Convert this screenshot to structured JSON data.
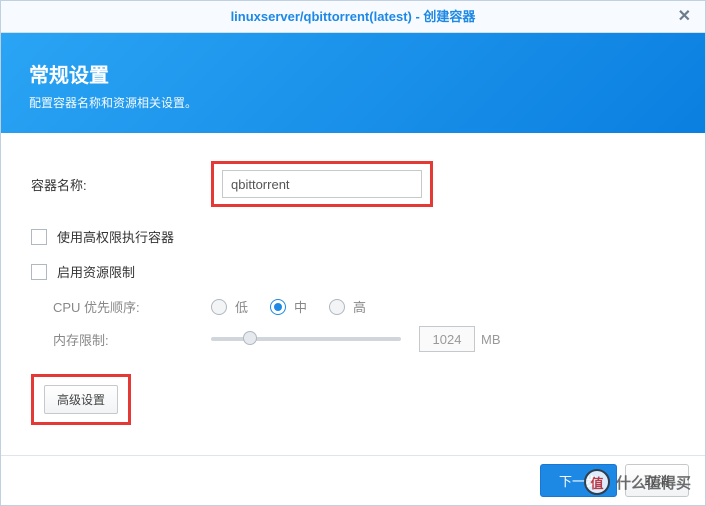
{
  "titlebar": {
    "title": "linuxserver/qbittorrent(latest) - 创建容器",
    "close": "✕"
  },
  "header": {
    "title": "常规设置",
    "subtitle": "配置容器名称和资源相关设置。"
  },
  "form": {
    "container_name_label": "容器名称:",
    "container_name_value": "qbittorrent",
    "privileged_label": "使用高权限执行容器",
    "resource_limit_label": "启用资源限制",
    "cpu_priority_label": "CPU 优先顺序:",
    "cpu_options": {
      "low": "低",
      "mid": "中",
      "high": "高"
    },
    "cpu_selected": "mid",
    "mem_limit_label": "内存限制:",
    "mem_value": "1024",
    "mem_unit": "MB",
    "advanced_label": "高级设置"
  },
  "footer": {
    "next": "下一步",
    "cancel": "取消"
  },
  "watermark": {
    "badge": "值",
    "text": "什么值得买"
  }
}
